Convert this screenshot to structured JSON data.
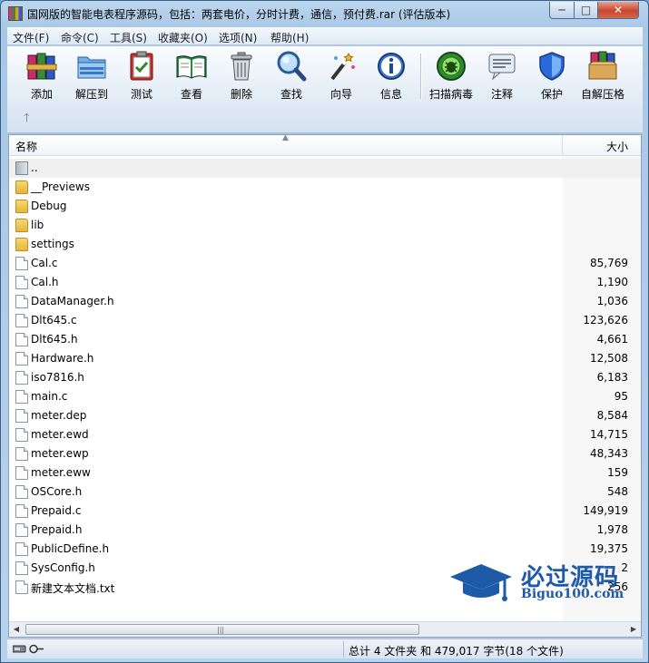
{
  "window": {
    "title": "国网版的智能电表程序源码，包括：两套电价，分时计费，通信，预付费.rar (评估版本)",
    "minimize_glyph": "─",
    "maximize_glyph": "□",
    "close_glyph": "✕"
  },
  "menu": [
    {
      "label": "文件(F)"
    },
    {
      "label": "命令(C)"
    },
    {
      "label": "工具(S)"
    },
    {
      "label": "收藏夹(O)"
    },
    {
      "label": "选项(N)"
    },
    {
      "label": "帮助(H)"
    }
  ],
  "toolbar": {
    "tools": [
      {
        "label": "添加",
        "icon": "add-books-icon"
      },
      {
        "label": "解压到",
        "icon": "extract-folder-icon"
      },
      {
        "label": "测试",
        "icon": "test-clipboard-icon"
      },
      {
        "label": "查看",
        "icon": "view-book-icon"
      },
      {
        "label": "删除",
        "icon": "trash-can-icon"
      },
      {
        "label": "查找",
        "icon": "magnifier-icon"
      },
      {
        "label": "向导",
        "icon": "wizard-wand-icon"
      },
      {
        "label": "信息",
        "icon": "info-icon"
      },
      {
        "label": "扫描病毒",
        "icon": "virus-scan-icon"
      },
      {
        "label": "注释",
        "icon": "comment-icon"
      },
      {
        "label": "保护",
        "icon": "shield-icon"
      },
      {
        "label": "自解压格",
        "icon": "sfx-box-icon"
      }
    ],
    "up_glyph": "🡑"
  },
  "columns": {
    "name": "名称",
    "size": "大小"
  },
  "files": [
    {
      "name": "..",
      "size": "",
      "kind": "up"
    },
    {
      "name": "__Previews",
      "size": "",
      "kind": "folder"
    },
    {
      "name": "Debug",
      "size": "",
      "kind": "folder"
    },
    {
      "name": "lib",
      "size": "",
      "kind": "folder"
    },
    {
      "name": "settings",
      "size": "",
      "kind": "folder"
    },
    {
      "name": "Cal.c",
      "size": "85,769",
      "kind": "file"
    },
    {
      "name": "Cal.h",
      "size": "1,190",
      "kind": "file"
    },
    {
      "name": "DataManager.h",
      "size": "1,036",
      "kind": "file"
    },
    {
      "name": "Dlt645.c",
      "size": "123,626",
      "kind": "file"
    },
    {
      "name": "Dlt645.h",
      "size": "4,661",
      "kind": "file"
    },
    {
      "name": "Hardware.h",
      "size": "12,508",
      "kind": "file"
    },
    {
      "name": "iso7816.h",
      "size": "6,183",
      "kind": "file"
    },
    {
      "name": "main.c",
      "size": "95",
      "kind": "file"
    },
    {
      "name": "meter.dep",
      "size": "8,584",
      "kind": "file"
    },
    {
      "name": "meter.ewd",
      "size": "14,715",
      "kind": "file"
    },
    {
      "name": "meter.ewp",
      "size": "48,343",
      "kind": "file"
    },
    {
      "name": "meter.eww",
      "size": "159",
      "kind": "file"
    },
    {
      "name": "OSCore.h",
      "size": "548",
      "kind": "file"
    },
    {
      "name": "Prepaid.c",
      "size": "149,919",
      "kind": "file"
    },
    {
      "name": "Prepaid.h",
      "size": "1,978",
      "kind": "file"
    },
    {
      "name": "PublicDefine.h",
      "size": "19,375",
      "kind": "file"
    },
    {
      "name": "SysConfig.h",
      "size": "2",
      "kind": "file"
    },
    {
      "name": "新建文本文档.txt",
      "size": "256",
      "kind": "file"
    }
  ],
  "status": {
    "text": "总计 4 文件夹 和 479,017 字节(18 个文件)"
  },
  "watermark": {
    "title": "必过源码",
    "url": "Biguo100.com"
  },
  "colors": {
    "accent": "#1e5aa8",
    "folder": "#f0c850"
  }
}
